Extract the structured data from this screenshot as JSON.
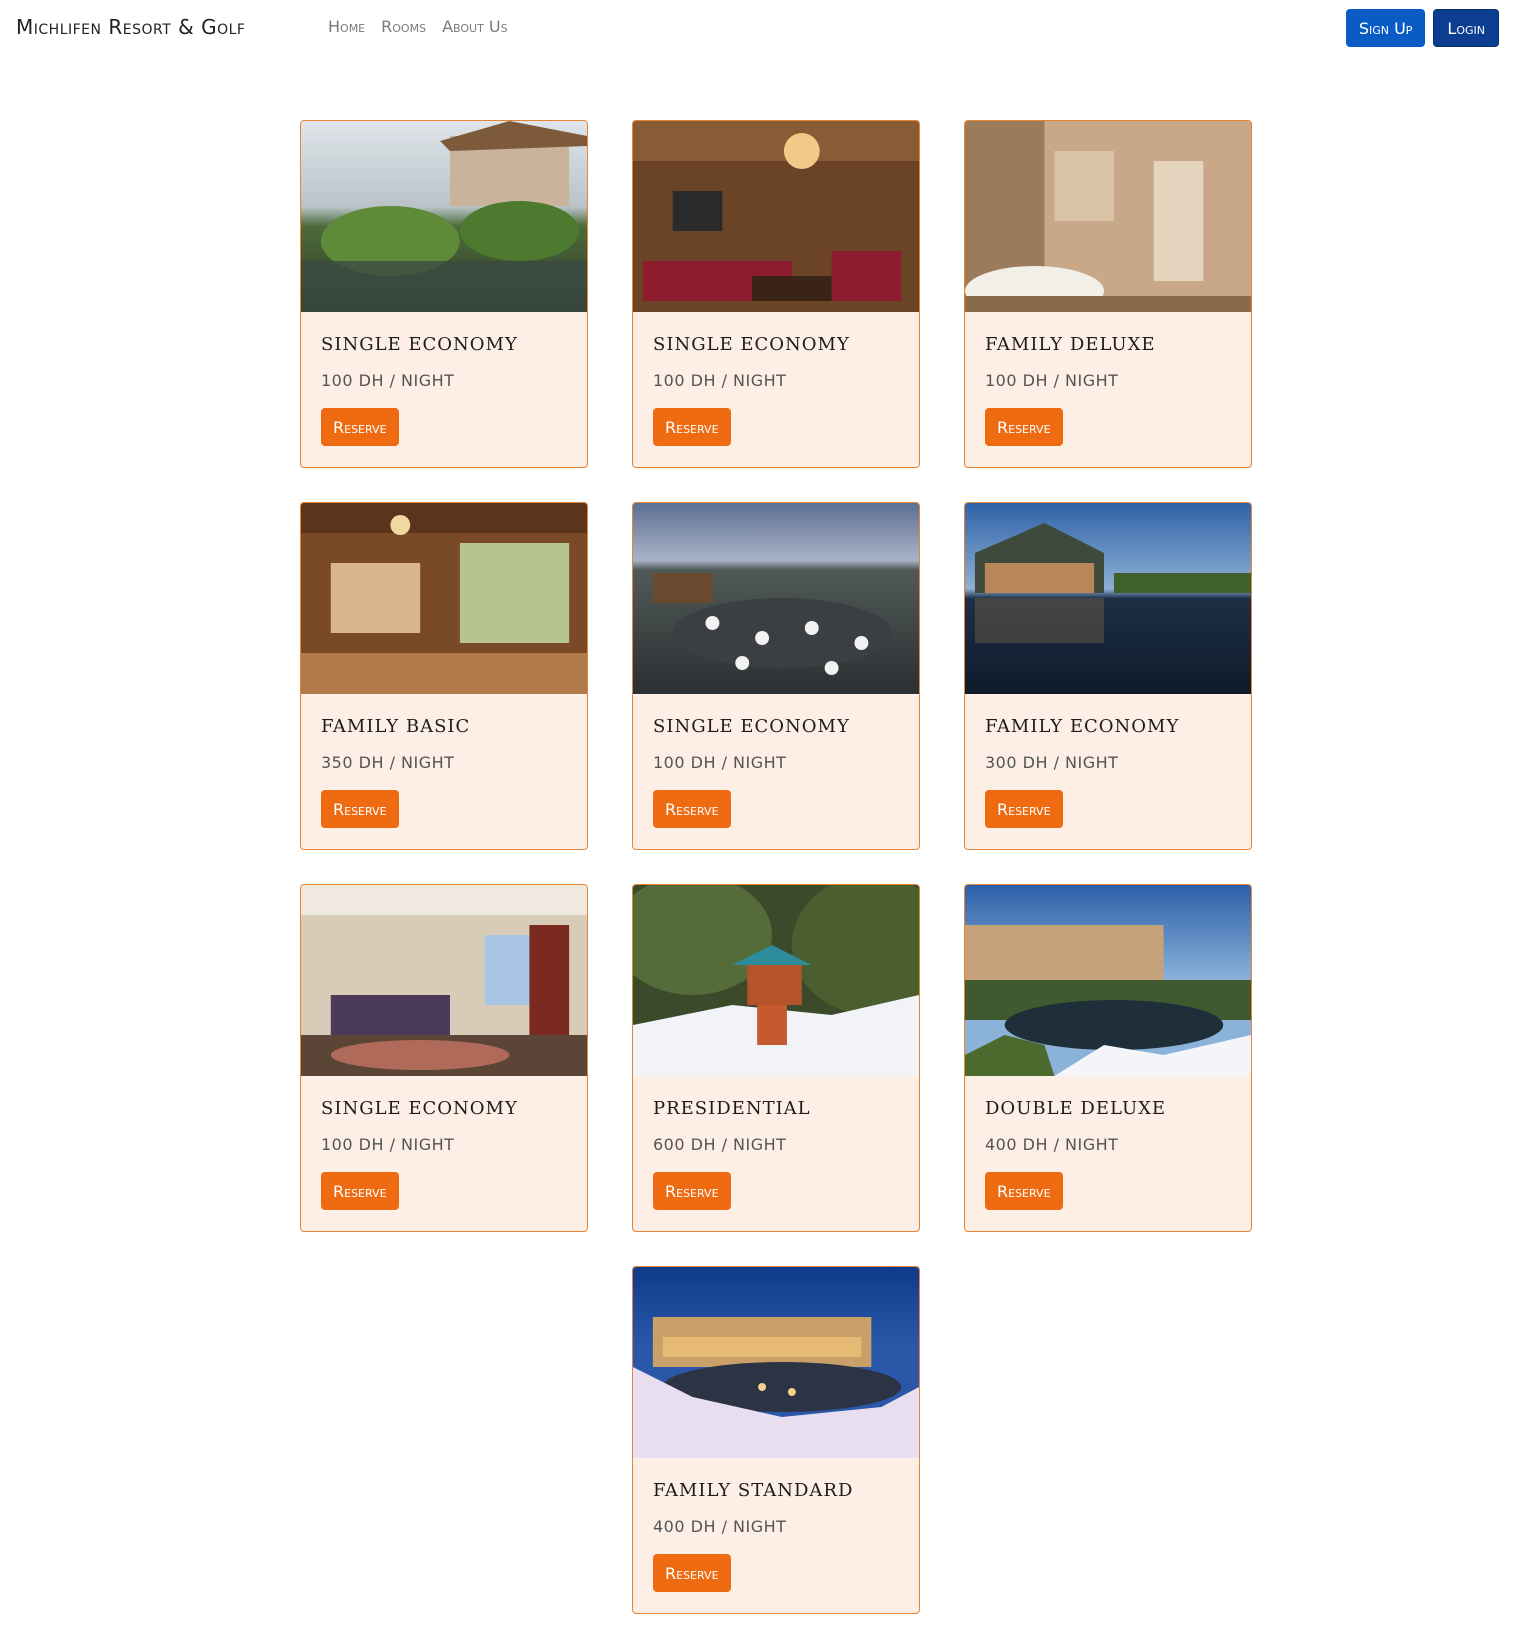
{
  "nav": {
    "brand": "Michlifen Resort & Golf",
    "links": [
      "Home",
      "Rooms",
      "About Us"
    ],
    "signup_label": "Sign Up",
    "login_label": "Login"
  },
  "colors": {
    "accent": "#ef6b12",
    "card_bg": "#fdeee6",
    "card_border": "#e88535",
    "primary": "#0a5bc4"
  },
  "rooms": [
    {
      "name": "Single Economy",
      "price": "100 DH / Night",
      "button": "Reserve"
    },
    {
      "name": "Single Economy",
      "price": "100 DH / Night",
      "button": "Reserve"
    },
    {
      "name": "Family Deluxe",
      "price": "100 DH / Night",
      "button": "Reserve"
    },
    {
      "name": "Family Basic",
      "price": "350 DH / Night",
      "button": "Reserve"
    },
    {
      "name": "Single Economy",
      "price": "100 DH / Night",
      "button": "Reserve"
    },
    {
      "name": "Family Economy",
      "price": "300 DH / Night",
      "button": "Reserve"
    },
    {
      "name": "Single Economy",
      "price": "100 DH / Night",
      "button": "Reserve"
    },
    {
      "name": "Presidential",
      "price": "600 DH / Night",
      "button": "Reserve"
    },
    {
      "name": "Double Deluxe",
      "price": "400 DH / Night",
      "button": "Reserve"
    },
    {
      "name": "Family Standard",
      "price": "400 DH / Night",
      "button": "Reserve"
    }
  ]
}
